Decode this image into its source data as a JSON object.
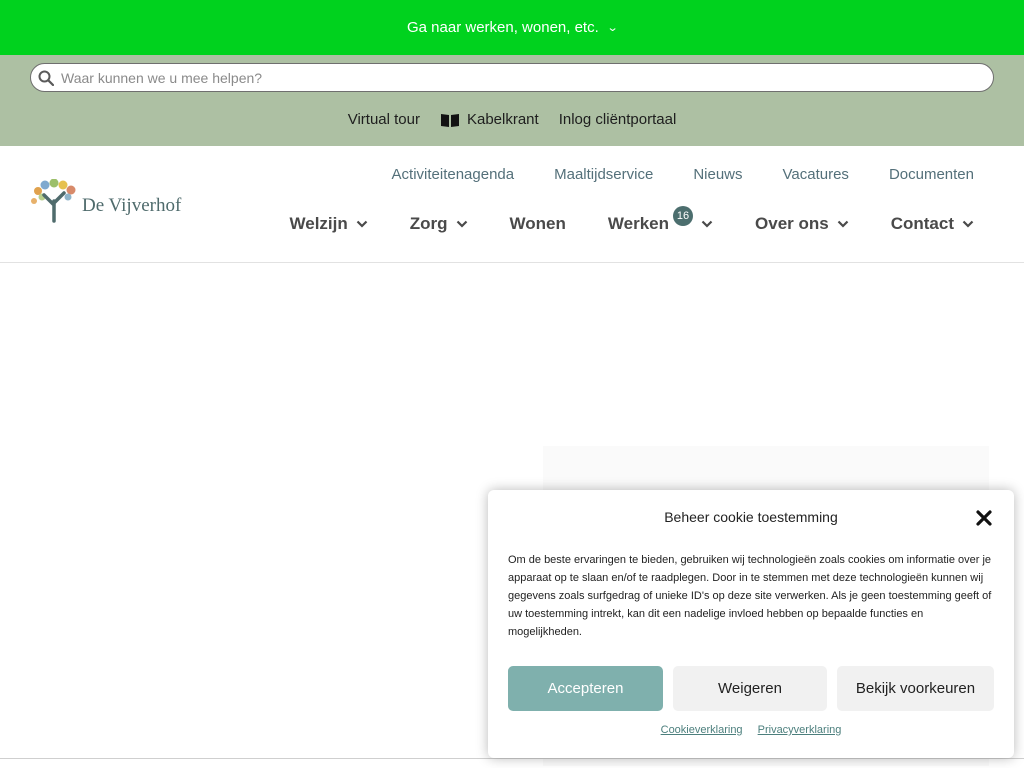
{
  "topbar": {
    "label": "Ga naar werken, wonen, etc."
  },
  "search": {
    "placeholder": "Waar kunnen we u mee helpen?"
  },
  "utility": {
    "virtual_tour": "Virtual tour",
    "kabelkrant": "Kabelkrant",
    "client_portal": "Inlog cliëntportaal"
  },
  "logo": {
    "text": "De Vijverhof"
  },
  "secondary_nav": [
    "Activiteitenagenda",
    "Maaltijdservice",
    "Nieuws",
    "Vacatures",
    "Documenten"
  ],
  "main_nav": {
    "welzijn": "Welzijn",
    "zorg": "Zorg",
    "wonen": "Wonen",
    "werken": "Werken",
    "werken_badge": "16",
    "over_ons": "Over ons",
    "contact": "Contact"
  },
  "cookie": {
    "title": "Beheer cookie toestemming",
    "body": "Om de beste ervaringen te bieden, gebruiken wij technologieën zoals cookies om informatie over je apparaat op te slaan en/of te raadplegen. Door in te stemmen met deze technologieën kunnen wij gegevens zoals surfgedrag of unieke ID's op deze site verwerken. Als je geen toestemming geeft of uw toestemming intrekt, kan dit een nadelige invloed hebben op bepaalde functies en mogelijkheden.",
    "accept": "Accepteren",
    "deny": "Weigeren",
    "prefs": "Bekijk voorkeuren",
    "cookie_statement": "Cookieverklaring",
    "privacy_statement": "Privacyverklaring"
  },
  "colors": {
    "topbar_green": "#00d21e",
    "band_sage": "#adc0a3",
    "accent_teal": "#7fb0ad",
    "nav_text": "#54707a"
  }
}
